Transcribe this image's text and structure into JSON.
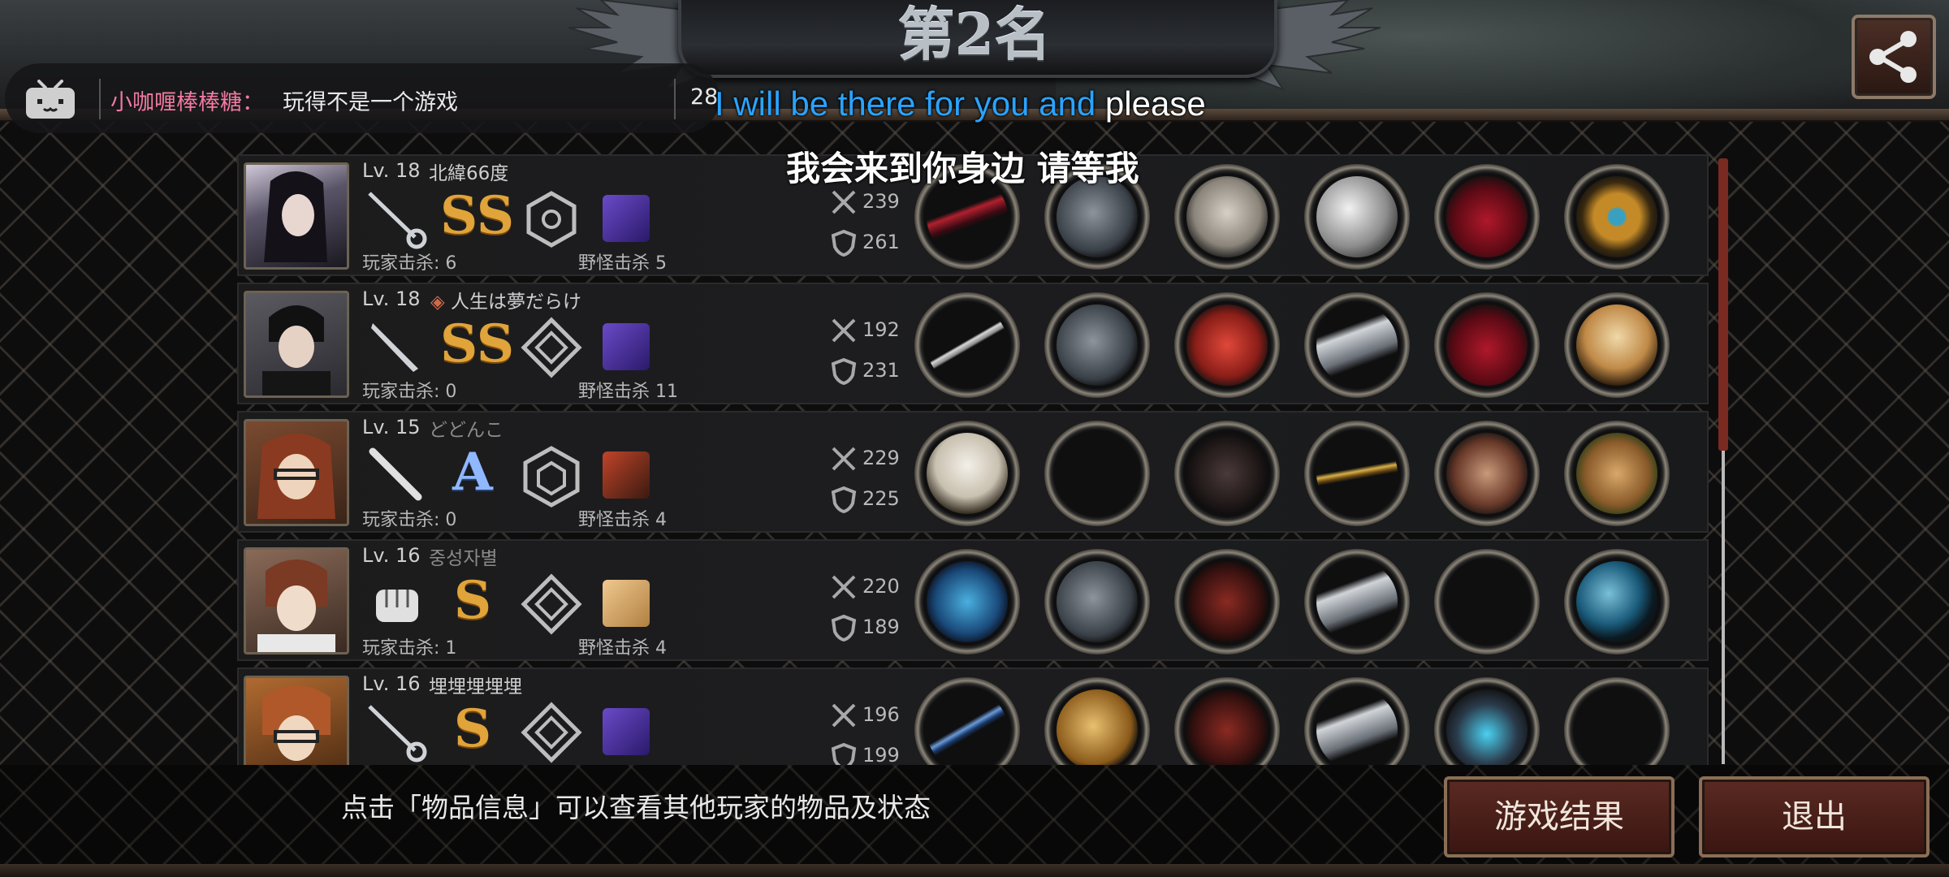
{
  "title": "第2名",
  "danmaku": {
    "user": "小咖喱棒棒糖：",
    "text": "玩得不是一个游戏",
    "count": "28"
  },
  "subtitle": {
    "en_highlight": "I will be there for you and",
    "en_rest": " please",
    "zh": "我会来到你身边 请等我"
  },
  "players": [
    {
      "level": "Lv. 18",
      "name": "北緯66度",
      "grade": "SS",
      "player_kills": "玩家击杀: 6",
      "monster_kills": "野怪击杀 5",
      "attack": "239",
      "defense": "261"
    },
    {
      "level": "Lv. 18",
      "name": "人生は夢だらけ",
      "grade": "SS",
      "player_kills": "玩家击杀: 0",
      "monster_kills": "野怪击杀 11",
      "attack": "192",
      "defense": "231"
    },
    {
      "level": "Lv. 15",
      "name": "どどんこ",
      "grade": "A",
      "player_kills": "玩家击杀: 0",
      "monster_kills": "野怪击杀 4",
      "attack": "229",
      "defense": "225"
    },
    {
      "level": "Lv. 16",
      "name": "중성자별",
      "grade": "S",
      "player_kills": "玩家击杀: 1",
      "monster_kills": "野怪击杀 4",
      "attack": "220",
      "defense": "189"
    },
    {
      "level": "Lv. 16",
      "name": "埋埋埋埋埋",
      "grade": "S",
      "player_kills": "",
      "monster_kills": "",
      "attack": "196",
      "defense": "199"
    }
  ],
  "tip": "点击「物品信息」可以查看其他玩家的物品及状态",
  "buttons": {
    "result": "游戏结果",
    "exit": "退出"
  },
  "icons": {
    "share": "share-icon",
    "bilibili": "bilibili-tv-icon",
    "attack": "crossed-swords-icon",
    "defense": "shield-icon"
  },
  "colors": {
    "accent_red": "#7a2a20",
    "danmaku_user": "#f07aa0",
    "subtitle_blue": "#2aa3ff",
    "grade_gold": "#e0a43a"
  }
}
